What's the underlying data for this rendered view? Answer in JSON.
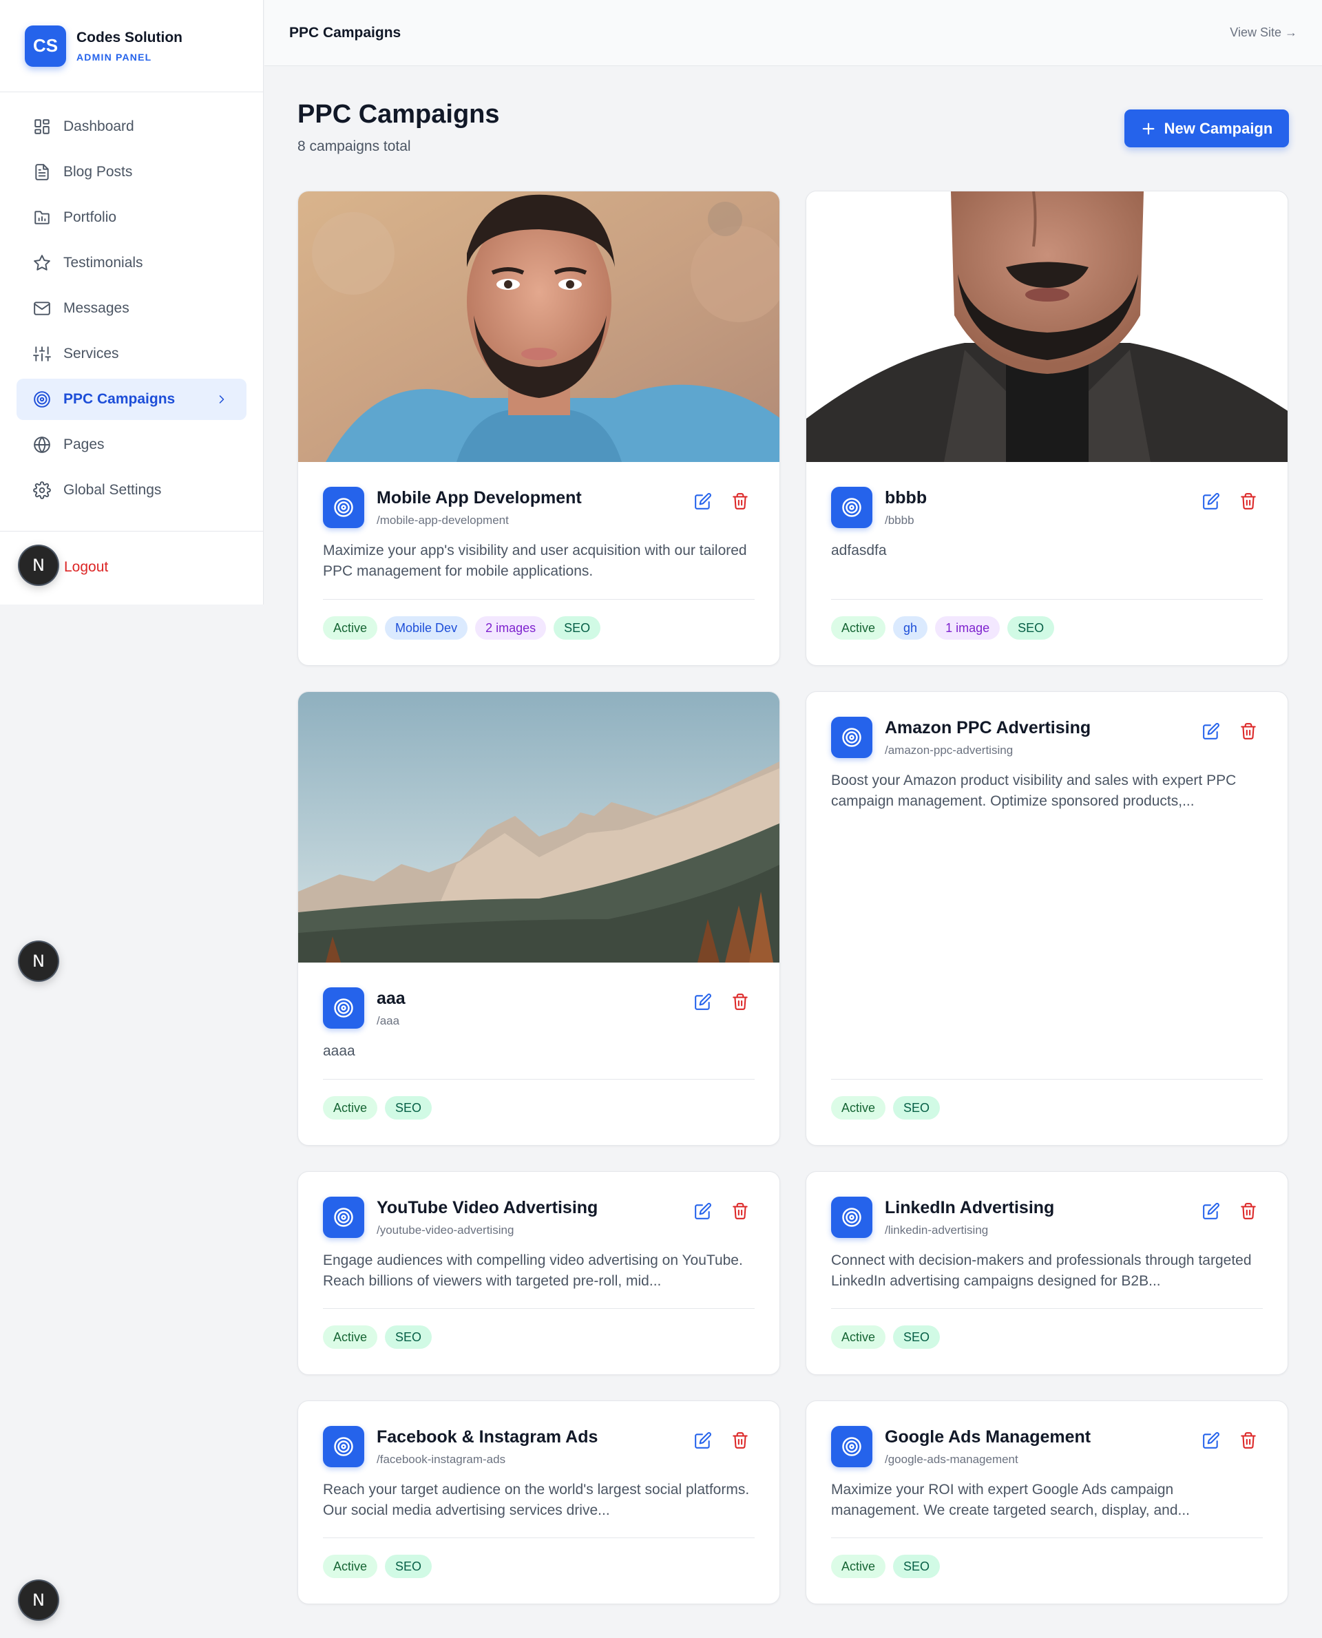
{
  "brand": {
    "logo": "CS",
    "name": "Codes Solution",
    "sub": "ADMIN PANEL"
  },
  "nav": [
    {
      "label": "Dashboard",
      "icon": "dashboard-icon"
    },
    {
      "label": "Blog Posts",
      "icon": "document-icon"
    },
    {
      "label": "Portfolio",
      "icon": "portfolio-icon"
    },
    {
      "label": "Testimonials",
      "icon": "star-icon"
    },
    {
      "label": "Messages",
      "icon": "mail-icon"
    },
    {
      "label": "Services",
      "icon": "sliders-icon"
    },
    {
      "label": "PPC Campaigns",
      "icon": "target-icon",
      "active": true
    },
    {
      "label": "Pages",
      "icon": "globe-icon"
    },
    {
      "label": "Global Settings",
      "icon": "gear-icon"
    }
  ],
  "logout_label": "Logout",
  "badge_letter": "N",
  "topbar": {
    "title": "PPC Campaigns",
    "view_site": "View Site →"
  },
  "page": {
    "title": "PPC Campaigns",
    "subtitle": "8 campaigns total",
    "new_button": "New Campaign"
  },
  "colors": {
    "accent": "#2563eb",
    "danger": "#dc2626",
    "active_bg": "#e8f0fe"
  },
  "campaigns": [
    {
      "title": "Mobile App Development",
      "slug": "/mobile-app-development",
      "description": "Maximize your app's visibility and user acquisition with our tailored PPC management for mobile applications.",
      "tags": [
        "Active",
        "Mobile Dev",
        "2 images",
        "SEO"
      ]
    },
    {
      "title": "bbbb",
      "slug": "/bbbb",
      "description": "adfasdfa",
      "tags": [
        "Active",
        "gh",
        "1 image",
        "SEO"
      ]
    },
    {
      "title": "aaa",
      "slug": "/aaa",
      "description": "aaaa",
      "tags": [
        "Active",
        "SEO"
      ]
    },
    {
      "title": "Amazon PPC Advertising",
      "slug": "/amazon-ppc-advertising",
      "description": "Boost your Amazon product visibility and sales with expert PPC campaign management. Optimize sponsored products,...",
      "tags": [
        "Active",
        "SEO"
      ]
    },
    {
      "title": "YouTube Video Advertising",
      "slug": "/youtube-video-advertising",
      "description": "Engage audiences with compelling video advertising on YouTube. Reach billions of viewers with targeted pre-roll, mid...",
      "tags": [
        "Active",
        "SEO"
      ]
    },
    {
      "title": "LinkedIn Advertising",
      "slug": "/linkedin-advertising",
      "description": "Connect with decision-makers and professionals through targeted LinkedIn advertising campaigns designed for B2B...",
      "tags": [
        "Active",
        "SEO"
      ]
    },
    {
      "title": "Facebook & Instagram Ads",
      "slug": "/facebook-instagram-ads",
      "description": "Reach your target audience on the world's largest social platforms. Our social media advertising services drive...",
      "tags": [
        "Active",
        "SEO"
      ]
    },
    {
      "title": "Google Ads Management",
      "slug": "/google-ads-management",
      "description": "Maximize your ROI with expert Google Ads campaign management. We create targeted search, display, and...",
      "tags": [
        "Active",
        "SEO"
      ]
    }
  ]
}
